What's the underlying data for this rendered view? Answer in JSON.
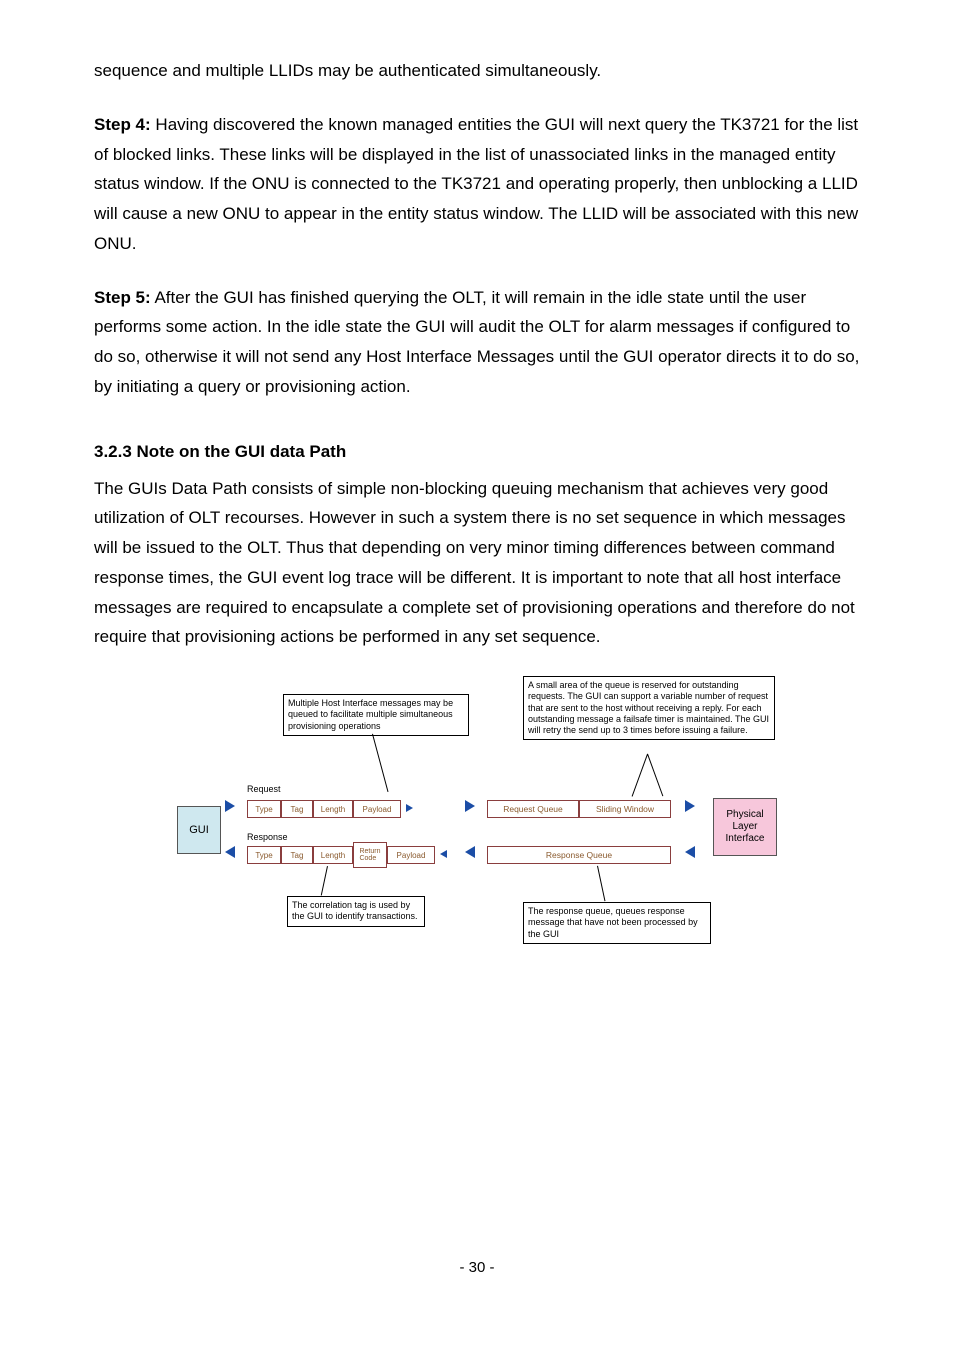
{
  "para_intro": "sequence and multiple LLIDs may be authenticated simultaneously.",
  "step4_bold": "Step 4:",
  "step4_body": " Having discovered the known managed entities the GUI will next query the TK3721 for the list of blocked links. These links will be displayed in the list of unassociated links in the managed entity status window. If the ONU is connected to the TK3721 and operating properly, then unblocking a LLID will cause a new ONU to appear in the entity status window. The LLID will be associated with this new ONU.",
  "step5_bold": "Step 5:",
  "step5_body": " After the GUI has finished querying the OLT, it will remain in the idle state until the user performs some action. In the idle state the GUI will audit the OLT for alarm messages if configured to do so, otherwise it will not send any Host Interface Messages until the GUI operator directs it to do so, by initiating a query or provisioning action.",
  "heading_323": "3.2.3 Note on the GUI data Path",
  "para_323": "The GUIs Data Path consists of simple non-blocking queuing mechanism that achieves very good utilization of OLT recourses. However in such a system there is no set sequence in which messages will be issued to the OLT. Thus that depending on very minor timing differences between command response times, the GUI event log trace will be different. It is important to note that all host interface messages are required to encapsulate a complete set of provisioning operations and therefore do not require that provisioning actions be performed in any set sequence.",
  "page_number": "- 30 -",
  "diagram": {
    "note_top_left": "Multiple Host Interface messages may be queued  to facilitate multiple simultaneous provisioning operations",
    "note_top_right": "A small area of the queue is reserved for outstanding requests. The GUI can support a variable number of request that are sent to the host without receiving a reply. For each outstanding message a failsafe timer is maintained. The GUI will retry the send up to 3 times before issuing a failure.",
    "note_bot_left": "The correlation tag is used by the GUI to identify transactions.",
    "note_bot_right": "The response queue, queues response message that have not been processed by the GUI",
    "gui": "GUI",
    "phy": "Physical\nLayer\nInterface",
    "request_label": "Request",
    "response_label": "Response",
    "seg_type": "Type",
    "seg_tag": "Tag",
    "seg_length": "Length",
    "seg_payload": "Payload",
    "seg_return": "Return\nCode",
    "request_queue": "Request Queue",
    "sliding_window": "Sliding Window",
    "response_queue": "Response Queue"
  }
}
